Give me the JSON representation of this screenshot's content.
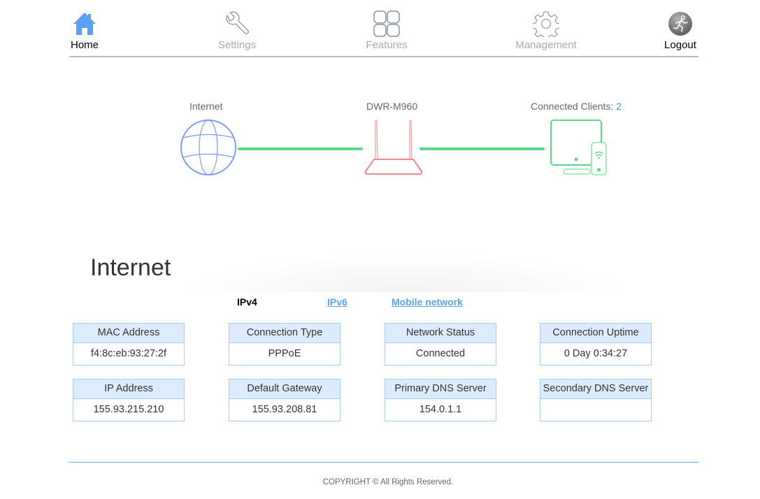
{
  "nav": {
    "items": [
      {
        "label": "Home",
        "icon": "home-icon",
        "active": true
      },
      {
        "label": "Settings",
        "icon": "wrench-icon",
        "active": false
      },
      {
        "label": "Features",
        "icon": "grid-icon",
        "active": false
      },
      {
        "label": "Management",
        "icon": "gear-icon",
        "active": false
      },
      {
        "label": "Logout",
        "icon": "running-man-icon",
        "active": false
      }
    ]
  },
  "topology": {
    "internet_label": "Internet",
    "device_label": "DWR-M960",
    "clients_label": "Connected Clients: ",
    "clients_count": "2",
    "colors": {
      "internet": "#7b9cf0",
      "router": "#f08a8a",
      "clients": "#5ad98b",
      "link": "#5ad98b"
    }
  },
  "internet": {
    "title": "Internet",
    "tabs": [
      {
        "label": "IPv4",
        "active": true
      },
      {
        "label": "IPv6",
        "active": false
      },
      {
        "label": "Mobile network",
        "active": false
      }
    ],
    "cards": [
      {
        "label": "MAC Address",
        "value": "f4:8c:eb:93:27:2f"
      },
      {
        "label": "Connection Type",
        "value": "PPPoE"
      },
      {
        "label": "Network Status",
        "value": "Connected"
      },
      {
        "label": "Connection Uptime",
        "value": "0 Day 0:34:27"
      },
      {
        "label": "IP Address",
        "value": "155.93.215.210"
      },
      {
        "label": "Default Gateway",
        "value": "155.93.208.81"
      },
      {
        "label": "Primary DNS Server",
        "value": "154.0.1.1"
      },
      {
        "label": "Secondary DNS Server",
        "value": ""
      }
    ]
  },
  "footer": {
    "copyright": "COPYRIGHT © All Rights Reserved."
  }
}
